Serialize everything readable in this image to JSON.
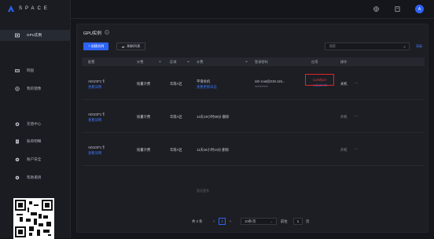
{
  "brand": {
    "name": "SPACE",
    "accent": "#2d62f5"
  },
  "topbar": {
    "icons": [
      "globe-icon",
      "document-icon"
    ],
    "avatar_letter": "A"
  },
  "sidebar": {
    "items": [
      {
        "label": "GPU实例",
        "icon": "gpu-icon",
        "active": true
      },
      {
        "label": "网盘",
        "icon": "drive-icon",
        "active": false
      },
      {
        "label": "我的镜像",
        "icon": "image-icon",
        "active": false
      },
      {
        "label": "充值中心",
        "icon": "recharge-icon",
        "active": false
      },
      {
        "label": "账单明细",
        "icon": "bill-icon",
        "active": false
      },
      {
        "label": "账户安全",
        "icon": "security-icon",
        "active": false
      },
      {
        "label": "帮助邀请",
        "icon": "help-icon",
        "active": false
      }
    ]
  },
  "main": {
    "title": "GPU实例",
    "create_button": "+ 创建实例",
    "refresh_button": "刷新列表",
    "search_placeholder": "搜索",
    "search_link": "高级",
    "columns": [
      "配置",
      "计费",
      "区域",
      "计费",
      "登录密码",
      "应用",
      "操作"
    ],
    "rows": [
      {
        "config": "AD103*1卡",
        "detail": "查看详情",
        "billing": "按量计费",
        "region": "华南A区",
        "status_line1": "平滑关机",
        "status_line2": "查看更新日志",
        "login": "ssh root@219.115...",
        "password": "**********",
        "app1": "ComfyUI",
        "app2": "AutoSVG",
        "action": "关机",
        "more": "⋯"
      },
      {
        "config": "AD103*1卡",
        "detail": "查看详情",
        "billing": "按量计费",
        "region": "华南A区",
        "status_line1": "14天19小时59分 删除",
        "status_line2": "",
        "login": "",
        "password": "",
        "app1": "",
        "app2": "",
        "action": "开机",
        "more": "⋯"
      },
      {
        "config": "AD103*1卡",
        "detail": "查看详情",
        "billing": "按量计费",
        "region": "华南A区",
        "status_line1": "11天16小时13分 删除",
        "status_line2": "",
        "login": "",
        "password": "",
        "app1": "",
        "app2": "",
        "action": "开机",
        "more": "⋯"
      }
    ],
    "empty_note": "暂无更多",
    "pager": {
      "total": "共 3 条",
      "prev": "<",
      "current": "1",
      "next": ">",
      "page_size": "10条/页",
      "goto_label": "前往",
      "goto_value": "1",
      "page_suffix": "页"
    }
  }
}
